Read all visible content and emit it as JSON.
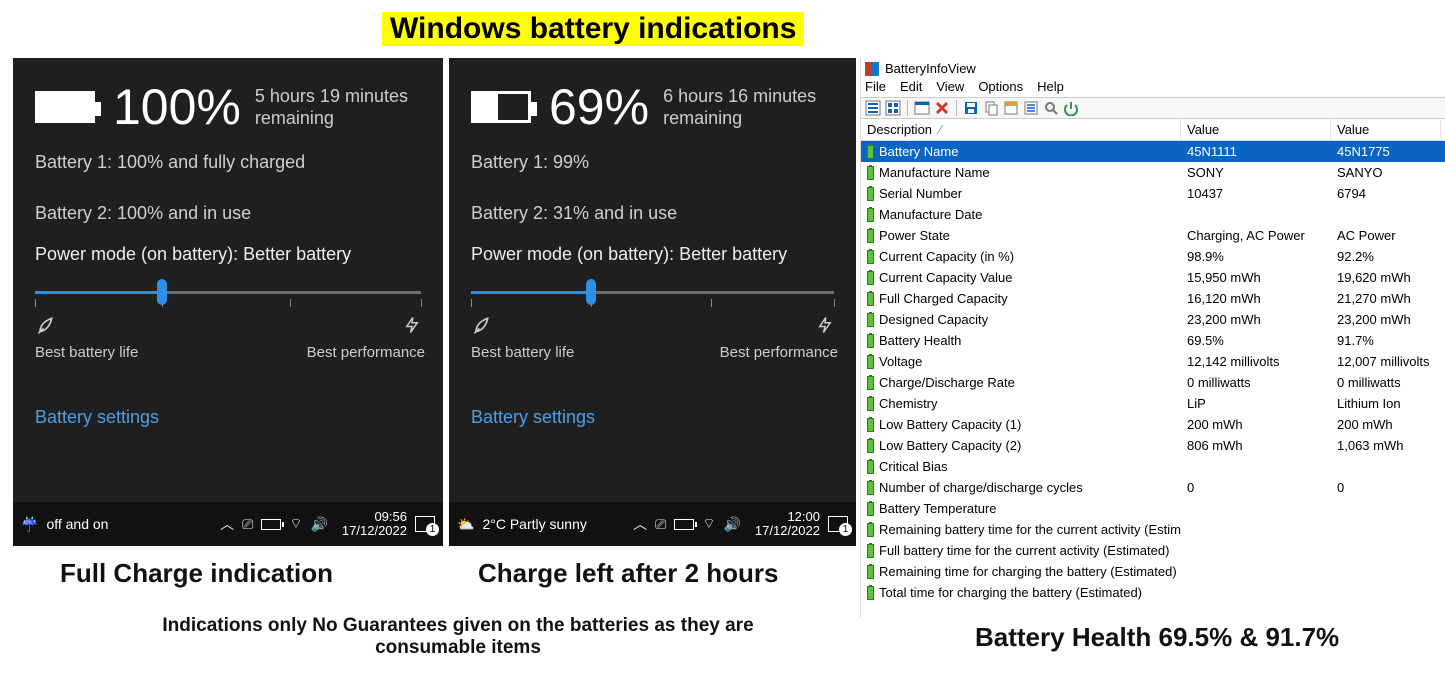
{
  "heading": "Windows battery indications",
  "flyout1": {
    "percent": "100%",
    "fill_pct": 100,
    "remaining1": "5 hours 19 minutes",
    "remaining2": "remaining",
    "batt1": "Battery 1: 100% and fully charged",
    "batt2": "Battery 2: 100% and in use",
    "power_mode_label": "Power mode (on battery): Better battery",
    "slider_pos_pct": 33,
    "left_label": "Best battery life",
    "right_label": "Best performance",
    "settings": "Battery settings",
    "tb_left": "off and on",
    "time": "09:56",
    "date": "17/12/2022"
  },
  "flyout2": {
    "percent": "69%",
    "fill_pct": 45,
    "remaining1": "6 hours 16 minutes",
    "remaining2": "remaining",
    "batt1": "Battery 1: 99%",
    "batt2": "Battery 2: 31% and in use",
    "power_mode_label": "Power mode (on battery): Better battery",
    "slider_pos_pct": 33,
    "left_label": "Best battery life",
    "right_label": "Best performance",
    "settings": "Battery settings",
    "tb_left": "2°C  Partly sunny",
    "time": "12:00",
    "date": "17/12/2022"
  },
  "captions": {
    "left": "Full Charge indication",
    "mid": "Charge left after 2 hours",
    "disclaimer1": "Indications only No Guarantees given on the batteries as they are",
    "disclaimer2": "consumable items",
    "biv": "Battery Health 69.5% & 91.7%"
  },
  "biv": {
    "title": "BatteryInfoView",
    "menu": [
      "File",
      "Edit",
      "View",
      "Options",
      "Help"
    ],
    "columns": [
      "Description",
      "Value",
      "Value"
    ],
    "rows": [
      {
        "d": "Battery Name",
        "v1": "45N1111",
        "v2": "45N1775",
        "sel": true
      },
      {
        "d": "Manufacture Name",
        "v1": "SONY",
        "v2": "SANYO"
      },
      {
        "d": "Serial Number",
        "v1": "10437",
        "v2": "6794"
      },
      {
        "d": "Manufacture Date",
        "v1": "",
        "v2": ""
      },
      {
        "d": "Power State",
        "v1": "Charging, AC Power",
        "v2": "AC Power"
      },
      {
        "d": "Current Capacity (in %)",
        "v1": "98.9%",
        "v2": "92.2%"
      },
      {
        "d": "Current Capacity Value",
        "v1": "15,950 mWh",
        "v2": "19,620 mWh"
      },
      {
        "d": "Full Charged Capacity",
        "v1": "16,120 mWh",
        "v2": "21,270 mWh"
      },
      {
        "d": "Designed Capacity",
        "v1": "23,200 mWh",
        "v2": "23,200 mWh"
      },
      {
        "d": "Battery Health",
        "v1": "69.5%",
        "v2": "91.7%"
      },
      {
        "d": "Voltage",
        "v1": "12,142 millivolts",
        "v2": "12,007 millivolts"
      },
      {
        "d": "Charge/Discharge Rate",
        "v1": "0 milliwatts",
        "v2": "0 milliwatts"
      },
      {
        "d": "Chemistry",
        "v1": "LiP",
        "v2": "Lithium Ion"
      },
      {
        "d": "Low Battery Capacity (1)",
        "v1": "200 mWh",
        "v2": "200 mWh"
      },
      {
        "d": "Low Battery Capacity (2)",
        "v1": "806 mWh",
        "v2": "1,063 mWh"
      },
      {
        "d": "Critical Bias",
        "v1": "",
        "v2": ""
      },
      {
        "d": "Number of charge/discharge cycles",
        "v1": "0",
        "v2": "0"
      },
      {
        "d": "Battery Temperature",
        "v1": "",
        "v2": ""
      },
      {
        "d": "Remaining battery time for the current activity (Estimated)",
        "v1": "",
        "v2": ""
      },
      {
        "d": "Full battery time for the current activity (Estimated)",
        "v1": "",
        "v2": ""
      },
      {
        "d": "Remaining time for charging the battery (Estimated)",
        "v1": "",
        "v2": ""
      },
      {
        "d": "Total  time for charging the battery (Estimated)",
        "v1": "",
        "v2": ""
      }
    ]
  }
}
